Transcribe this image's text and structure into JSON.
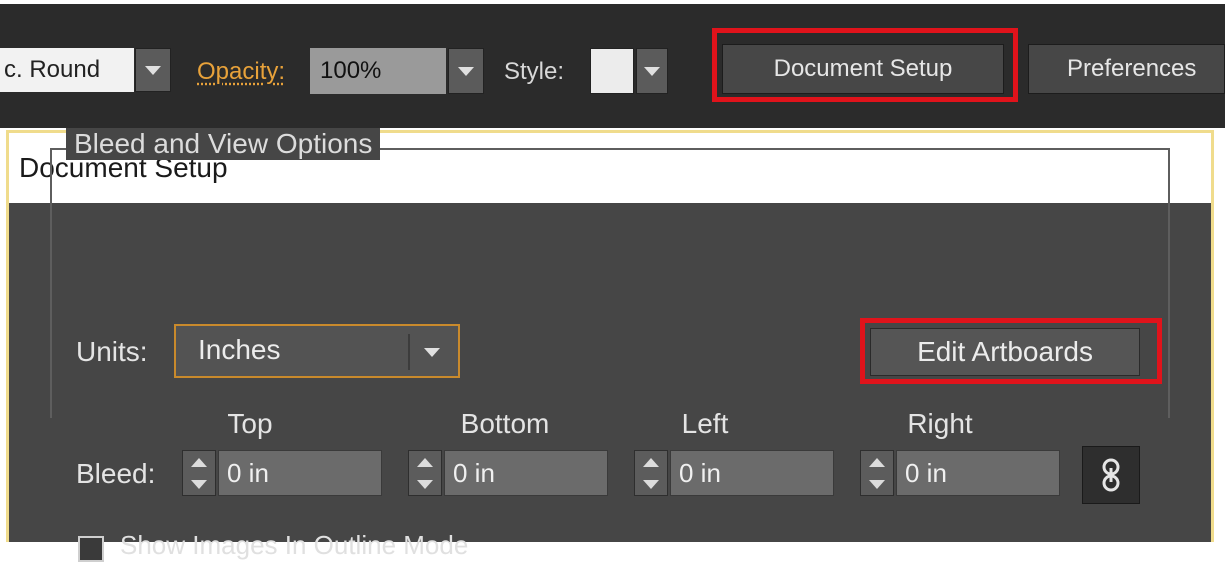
{
  "toolbar": {
    "corner_value": "c. Round",
    "opacity_label": "Opacity:",
    "opacity_value": "100%",
    "style_label": "Style:",
    "document_setup_label": "Document Setup",
    "preferences_label": "Preferences"
  },
  "dialog": {
    "title": "Document Setup",
    "group_title": "Bleed and View Options",
    "units_label": "Units:",
    "units_value": "Inches",
    "edit_artboards_label": "Edit Artboards",
    "bleed_label": "Bleed:",
    "bleed": [
      {
        "heading": "Top",
        "value": "0 in"
      },
      {
        "heading": "Bottom",
        "value": "0 in"
      },
      {
        "heading": "Left",
        "value": "0 in"
      },
      {
        "heading": "Right",
        "value": "0 in"
      }
    ],
    "show_option_label": "Show Images In Outline Mode"
  },
  "colors": {
    "toolbar_bg": "#2b2b2b",
    "dialog_bg": "#464646",
    "highlight_red": "#e0131b",
    "opacity_orange": "#e8a23a",
    "focus_border": "#c98a2c"
  },
  "icons": {
    "dropdown": "chevron-down-icon",
    "spinner": "up-down-arrows-icon",
    "link": "chain-link-icon"
  }
}
